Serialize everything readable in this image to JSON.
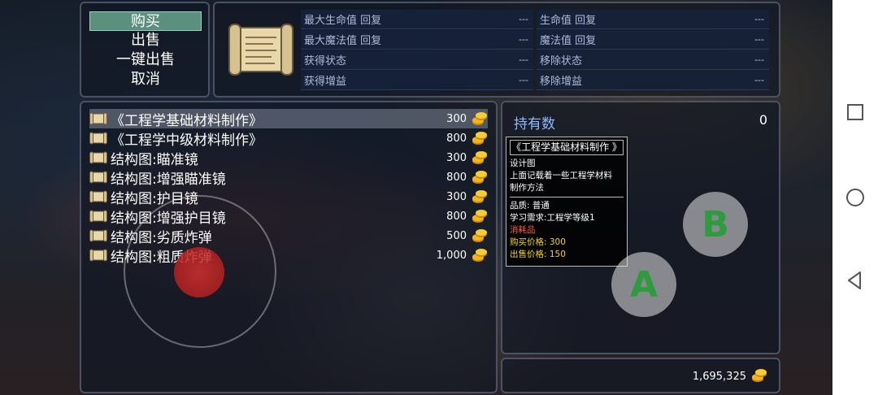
{
  "menu": {
    "items": [
      {
        "label": "购买",
        "active": true
      },
      {
        "label": "出售",
        "active": false
      },
      {
        "label": "一键出售",
        "active": false
      },
      {
        "label": "取消",
        "active": false
      }
    ]
  },
  "effects": {
    "rows": [
      [
        {
          "label": "最大生命值 回复",
          "value": "---"
        },
        {
          "label": "生命值 回复",
          "value": "---"
        }
      ],
      [
        {
          "label": "最大魔法值 回复",
          "value": "---"
        },
        {
          "label": "魔法值 回复",
          "value": "---"
        }
      ],
      [
        {
          "label": "获得状态",
          "value": "---"
        },
        {
          "label": "移除状态",
          "value": "---"
        }
      ],
      [
        {
          "label": "获得增益",
          "value": "---"
        },
        {
          "label": "移除增益",
          "value": "---"
        }
      ]
    ]
  },
  "items": [
    {
      "name": "《工程学基础材料制作》",
      "price": "300",
      "selected": true
    },
    {
      "name": "《工程学中级材料制作》",
      "price": "800",
      "selected": false
    },
    {
      "name": "结构图:瞄准镜",
      "price": "300",
      "selected": false
    },
    {
      "name": "结构图:增强瞄准镜",
      "price": "800",
      "selected": false
    },
    {
      "name": "结构图:护目镜",
      "price": "300",
      "selected": false
    },
    {
      "name": "结构图:增强护目镜",
      "price": "800",
      "selected": false
    },
    {
      "name": "结构图:劣质炸弹",
      "price": "500",
      "selected": false
    },
    {
      "name": "结构图:粗质炸弹",
      "price": "1,000",
      "selected": false
    }
  ],
  "detail": {
    "owned_label": "持有数",
    "owned_count": "0",
    "tooltip": {
      "title": "《工程学基础材料制作 》",
      "type": "设计图",
      "desc_1": "上面记载着一些工程学材料",
      "desc_2": "制作方法",
      "quality": "品质: 普通",
      "requirement": "学习需求:工程学等级1",
      "category": "消耗品",
      "buy_price": "购买价格: 300",
      "sell_price": "出售价格: 150"
    }
  },
  "gold": "1,695,325",
  "buttons": {
    "a": "A",
    "b": "B"
  },
  "colors": {
    "menu_active": "#5b8f7e",
    "coin": "#f2b51a",
    "owned_label": "#8fb8ff",
    "button_letter": "#2e9b3e"
  }
}
